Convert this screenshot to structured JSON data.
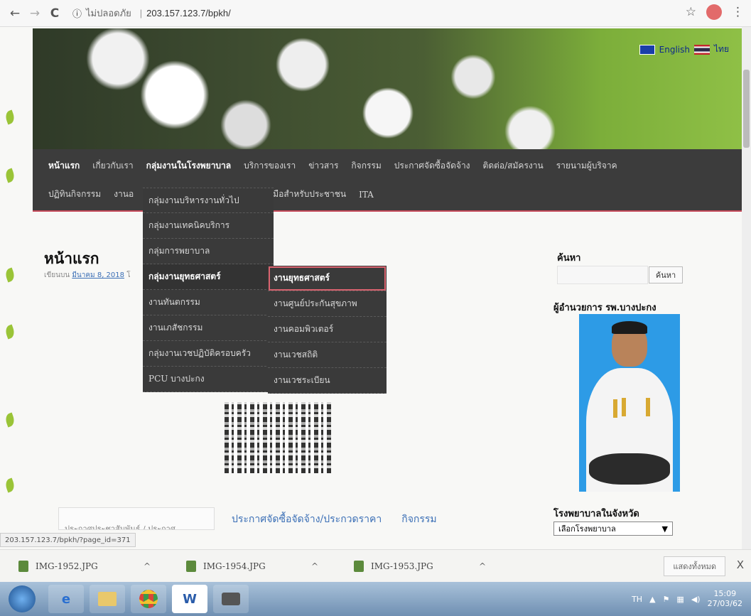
{
  "browser": {
    "security_label": "ไม่ปลอดภัย",
    "url": "203.157.123.7/bpkh/",
    "back_glyph": "←",
    "forward_glyph": "→",
    "reload_glyph": "C",
    "info_glyph": "ⓘ",
    "star_glyph": "☆",
    "menu_glyph": "⋮"
  },
  "header": {
    "lang_english": "English",
    "lang_thai": "ไทย"
  },
  "nav": {
    "row1": [
      "หน้าแรก",
      "เกี่ยวกับเรา",
      "กลุ่มงานในโรงพยาบาล",
      "บริการของเรา",
      "ข่าวสาร",
      "กิจกรรม",
      "ประกาศจัดซื้อจัดจ้าง",
      "ติดต่อ/สมัครงาน",
      "รายนามผู้บริจาค"
    ],
    "row2": [
      "ปฏิทินกิจกรรม",
      "งานอ",
      "คู่มือสำหรับประชาชน",
      "ITA"
    ]
  },
  "dropdown": {
    "items": [
      "กลุ่มงานบริหารงานทั่วไป",
      "กลุ่มงานเทคนิคบริการ",
      "กลุ่มการพยาบาล",
      "กลุ่มงานยุทธศาสตร์",
      "งานทันตกรรม",
      "งานเภสัชกรรม",
      "กลุ่มงานเวชปฏิบัติครอบครัว",
      "PCU บางปะกง"
    ]
  },
  "submenu": {
    "items": [
      "งานยุทธศาสตร์",
      "งานศูนย์ประกันสุขภาพ",
      "งานคอมพิวเตอร์",
      "งานเวชสถิติ",
      "งานเวชระเบียน"
    ]
  },
  "post": {
    "title": "หน้าแรก",
    "meta_prefix": "เขียนบน",
    "meta_date": "มีนาคม 8, 2018",
    "meta_suffix": "โ"
  },
  "bottom": {
    "box_text": "ประกาศประชาสัมพันธ์ / ประกาศ",
    "link1": "ประกาศจัดซื้อจัดจ้าง/ประกวดราคา",
    "link2": "กิจกรรม"
  },
  "sidebar": {
    "search_title": "ค้นหา",
    "search_button": "ค้นหา",
    "director_title": "ผู้อำนวยการ รพ.บางปะกง",
    "province_title": "โรงพยาบาลในจังหวัด",
    "province_select": "เลือกโรงพยาบาล"
  },
  "status_url": "203.157.123.7/bpkh/?page_id=371",
  "downloads": {
    "files": [
      "IMG-1952.JPG",
      "IMG-1954.JPG",
      "IMG-1953.JPG"
    ],
    "show_all": "แสดงทั้งหมด",
    "close": "X"
  },
  "taskbar": {
    "lang": "TH",
    "time": "15:09",
    "date": "27/03/62",
    "word_label": "W"
  },
  "colors": {
    "nav_bg": "#3c3c3c",
    "highlight": "#d9636f",
    "link": "#3b6fb6"
  }
}
